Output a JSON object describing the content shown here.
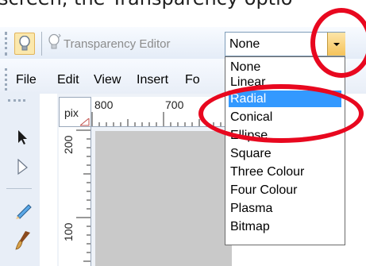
{
  "caption": "screen, the Transparency optio",
  "toolbar": {
    "transparency_editor_label": "Transparency Editor",
    "transparency_type": {
      "selected": "None",
      "options": [
        "None",
        "Linear",
        "Radial",
        "Conical",
        "Ellipse",
        "Square",
        "Three Colour",
        "Four Colour",
        "Plasma",
        "Bitmap"
      ],
      "highlighted": "Radial"
    }
  },
  "menubar": {
    "items": [
      "File",
      "Edit",
      "View",
      "Insert",
      "Fo"
    ]
  },
  "ruler": {
    "units": "pix",
    "h_ticks": [
      "800",
      "700"
    ],
    "v_ticks": [
      "200",
      "100"
    ]
  },
  "colors": {
    "highlight": "#3399ff",
    "annotation": "#e8081f",
    "canvas": "#c9c9c9"
  },
  "icons": [
    "bulb-icon",
    "transparency-editor-icon",
    "selector-arrow-icon",
    "contour-arrow-icon",
    "pen-icon",
    "brush-icon"
  ]
}
